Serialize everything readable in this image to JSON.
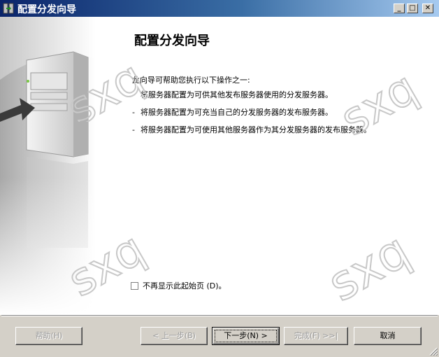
{
  "window": {
    "title": "配置分发向导",
    "minimize": "_",
    "maximize": "□",
    "close": "✕"
  },
  "page": {
    "title": "配置分发向导",
    "intro": "此向导可帮助您执行以下操作之一:",
    "bullet_marker": "-",
    "bullets": [
      "将服务器配置为可供其他发布服务器使用的分发服务器。",
      "将服务器配置为可充当自己的分发服务器的发布服务器。",
      "将服务器配置为可使用其他服务器作为其分发服务器的发布服务器。"
    ]
  },
  "checkbox": {
    "label": "不再显示此起始页 (D)。",
    "checked": false
  },
  "buttons": {
    "help": "帮助(H)",
    "back": "< 上一步(B)",
    "next": "下一步(N) >",
    "finish": "完成(F) >>|",
    "cancel": "取消"
  },
  "watermark": "sxq"
}
